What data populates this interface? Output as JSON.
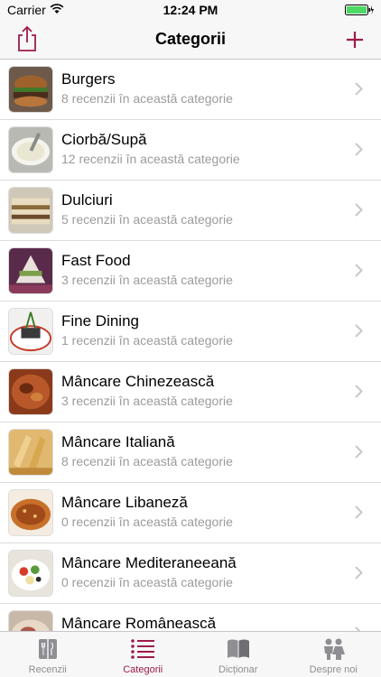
{
  "status": {
    "carrier": "Carrier",
    "time": "12:24 PM"
  },
  "nav": {
    "title": "Categorii",
    "left_icon": "share-icon",
    "right_icon": "plus-icon",
    "accent_color": "#9c1c4b"
  },
  "categories": [
    {
      "title": "Burgers",
      "subtitle": "8 recenzii în această categorie"
    },
    {
      "title": "Ciorbă/Supă",
      "subtitle": "12 recenzii în această categorie"
    },
    {
      "title": "Dulciuri",
      "subtitle": "5 recenzii în această categorie"
    },
    {
      "title": "Fast Food",
      "subtitle": "3 recenzii în această categorie"
    },
    {
      "title": "Fine Dining",
      "subtitle": "1 recenzii în această categorie"
    },
    {
      "title": "Mâncare Chinezească",
      "subtitle": "3 recenzii în această categorie"
    },
    {
      "title": "Mâncare Italiană",
      "subtitle": "8 recenzii în această categorie"
    },
    {
      "title": "Mâncare Libaneză",
      "subtitle": "0 recenzii în această categorie"
    },
    {
      "title": "Mâncare Mediteraneeană",
      "subtitle": "0 recenzii în această categorie"
    },
    {
      "title": "Mâncare Românească",
      "subtitle": ""
    }
  ],
  "tabs": [
    {
      "label": "Recenzii",
      "icon": "menu-book-icon",
      "active": false
    },
    {
      "label": "Categorii",
      "icon": "list-icon",
      "active": true
    },
    {
      "label": "Dicționar",
      "icon": "open-book-icon",
      "active": false
    },
    {
      "label": "Despre noi",
      "icon": "people-icon",
      "active": false
    }
  ]
}
